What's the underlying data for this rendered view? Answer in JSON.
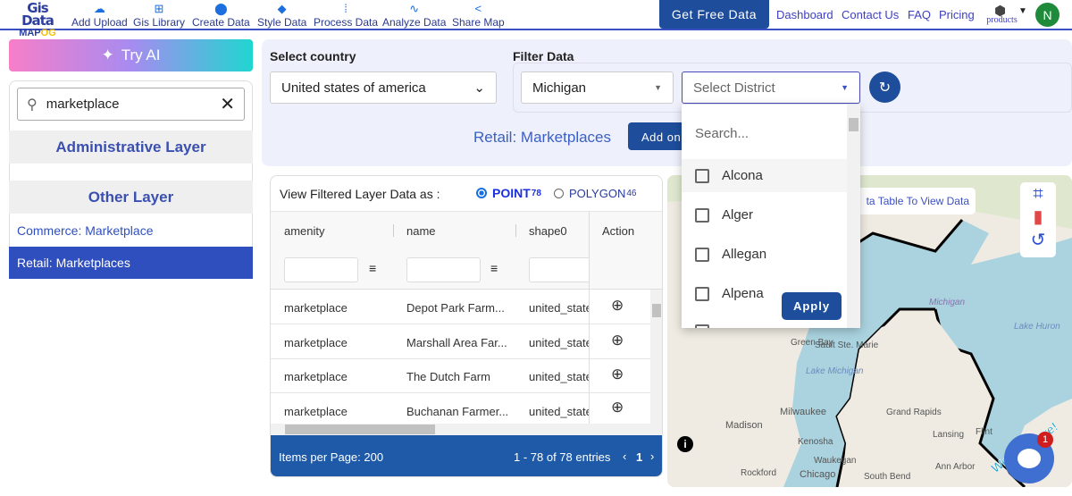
{
  "nav": {
    "logo_top": "Gis Data",
    "logo_bottom": "MAPOG",
    "items": [
      {
        "label": "Add Upload",
        "icon": "cloud-upload-icon"
      },
      {
        "label": "Gis Library",
        "icon": "library-add-icon"
      },
      {
        "label": "Create Data",
        "icon": "map-pin-icon"
      },
      {
        "label": "Style Data",
        "icon": "paint-bucket-icon"
      },
      {
        "label": "Process Data",
        "icon": "process-icon"
      },
      {
        "label": "Analyze Data",
        "icon": "analyze-icon"
      },
      {
        "label": "Share Map",
        "icon": "share-icon"
      }
    ],
    "get_free_data": "Get Free Data",
    "links": [
      "Dashboard",
      "Contact Us",
      "FAQ",
      "Pricing"
    ],
    "products": "products",
    "avatar": "N"
  },
  "left": {
    "try_ai": "Try AI",
    "search_value": "marketplace",
    "sections": [
      "Administrative Layer",
      "Other Layer"
    ],
    "layers": [
      {
        "label": "Commerce: Marketplace",
        "active": false
      },
      {
        "label": "Retail: Marketplaces",
        "active": true
      }
    ]
  },
  "filter": {
    "country_label": "Select country",
    "country_value": "United states of america",
    "filter_label": "Filter Data",
    "state_value": "Michigan",
    "district_placeholder": "Select District",
    "layer_title": "Retail: Marketplaces",
    "add_on": "Add on",
    "dropdown": {
      "search_placeholder": "Search...",
      "options": [
        "Alcona",
        "Alger",
        "Allegan",
        "Alpena"
      ],
      "apply": "Apply"
    }
  },
  "table": {
    "view_as": "View Filtered Layer Data as :",
    "point": "POINT",
    "point_count": "78",
    "polygon": "POLYGON",
    "polygon_count": "46",
    "selected": "POINT",
    "columns": [
      "amenity",
      "name",
      "shape0",
      "Action"
    ],
    "rows": [
      [
        "marketplace",
        "Depot Park Farm...",
        "united_state"
      ],
      [
        "marketplace",
        "Marshall Area Far...",
        "united_state"
      ],
      [
        "marketplace",
        "The Dutch Farm",
        "united_state"
      ],
      [
        "marketplace",
        "Buchanan Farmer...",
        "united_state"
      ]
    ],
    "items_per_page": "Items per Page: 200",
    "entries": "1 - 78 of 78 entries",
    "page": "1"
  },
  "map": {
    "tooltip": "ta Table To View Data",
    "labels": [
      "Sault Ste. Marie",
      "Michigan",
      "Lake Huron",
      "Green Bay",
      "Lake Michigan",
      "Milwaukee",
      "Madison",
      "Kenosha",
      "Waukegan",
      "Rockford",
      "Chicago",
      "Grand Rapids",
      "Lansing",
      "Flint",
      "Ann Arbor",
      "South Bend"
    ],
    "we_are_here": "We Are Here!",
    "chat_badge": "1"
  },
  "colors": {
    "primary": "#1e4d9b",
    "accent": "#3b4fc4",
    "active_layer": "#2f4fbf",
    "footer": "#1e5aa8"
  }
}
